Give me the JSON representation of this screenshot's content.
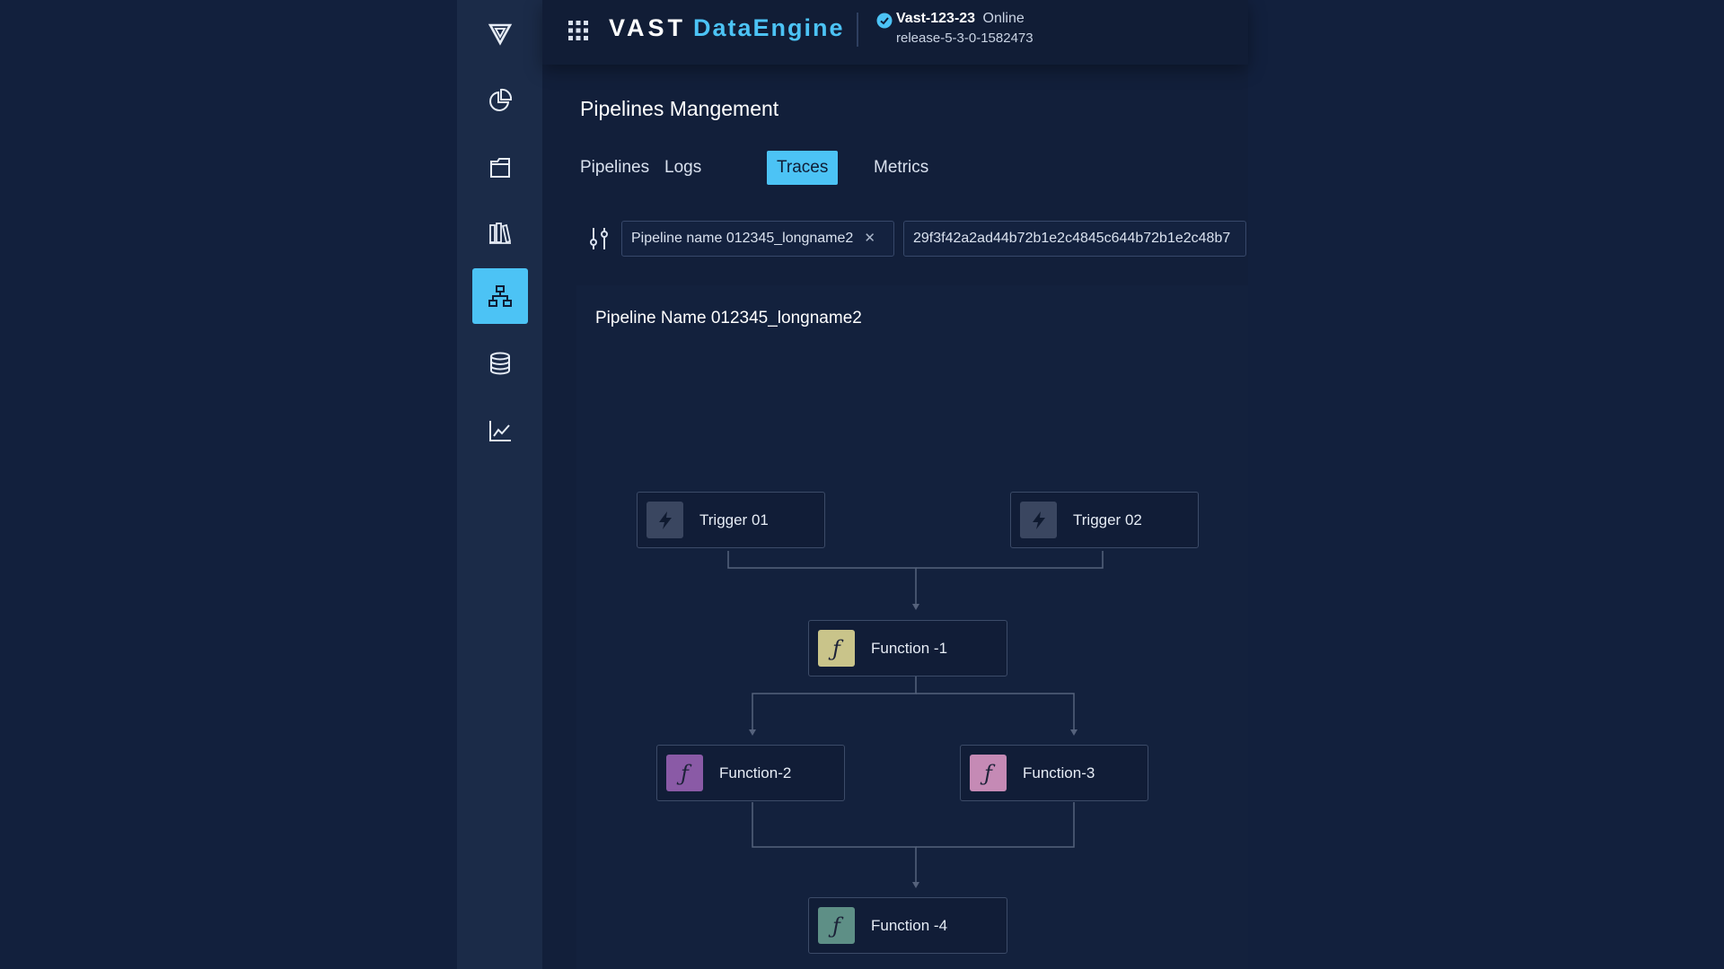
{
  "header": {
    "brand_main": "VAST",
    "brand_sub": "DataEngine",
    "cluster_name": "Vast-123-23",
    "cluster_status": "Online",
    "release": "release-5-3-0-1582473"
  },
  "sidebar": {
    "items": [
      {
        "name": "logo",
        "icon": "vast-logo-icon"
      },
      {
        "name": "dashboard",
        "icon": "pie-chart-icon"
      },
      {
        "name": "files",
        "icon": "folder-icon"
      },
      {
        "name": "library",
        "icon": "library-icon"
      },
      {
        "name": "pipelines",
        "icon": "hierarchy-icon",
        "active": true
      },
      {
        "name": "database",
        "icon": "database-icon"
      },
      {
        "name": "analytics",
        "icon": "line-chart-icon"
      }
    ]
  },
  "main": {
    "title": "Pipelines Mangement",
    "tabs": [
      {
        "label": "Pipelines"
      },
      {
        "label": "Logs"
      },
      {
        "label": "Traces",
        "active": true
      },
      {
        "label": "Metrics"
      }
    ],
    "filters": {
      "pipeline_chip": "Pipeline name 012345_longname2",
      "trace_chip": "29f3f42a2ad44b72b1e2c4845c644b72b1e2c48b7"
    },
    "pipeline_name": "Pipeline Name 012345_longname2"
  },
  "graph": {
    "nodes": [
      {
        "id": "trigger1",
        "label": "Trigger 01",
        "kind": "trigger",
        "icon": "lightning-icon"
      },
      {
        "id": "trigger2",
        "label": "Trigger 02",
        "kind": "trigger",
        "icon": "lightning-icon"
      },
      {
        "id": "fn1",
        "label": "Function -1",
        "kind": "function",
        "icon": "function-icon"
      },
      {
        "id": "fn2",
        "label": "Function-2",
        "kind": "function",
        "icon": "function-icon"
      },
      {
        "id": "fn3",
        "label": "Function-3",
        "kind": "function",
        "icon": "function-icon"
      },
      {
        "id": "fn4",
        "label": "Function -4",
        "kind": "function",
        "icon": "function-icon"
      }
    ],
    "edges": [
      [
        "trigger1",
        "fn1"
      ],
      [
        "trigger2",
        "fn1"
      ],
      [
        "fn1",
        "fn2"
      ],
      [
        "fn1",
        "fn3"
      ],
      [
        "fn2",
        "fn4"
      ],
      [
        "fn3",
        "fn4"
      ]
    ]
  },
  "colors": {
    "accent": "#4cc3f5",
    "trigger_icon": "#3a4660",
    "fn1_icon": "#c9c48a",
    "fn2_icon": "#8a5aa6",
    "fn3_icon": "#c58ab5",
    "fn4_icon": "#5e8f86"
  }
}
